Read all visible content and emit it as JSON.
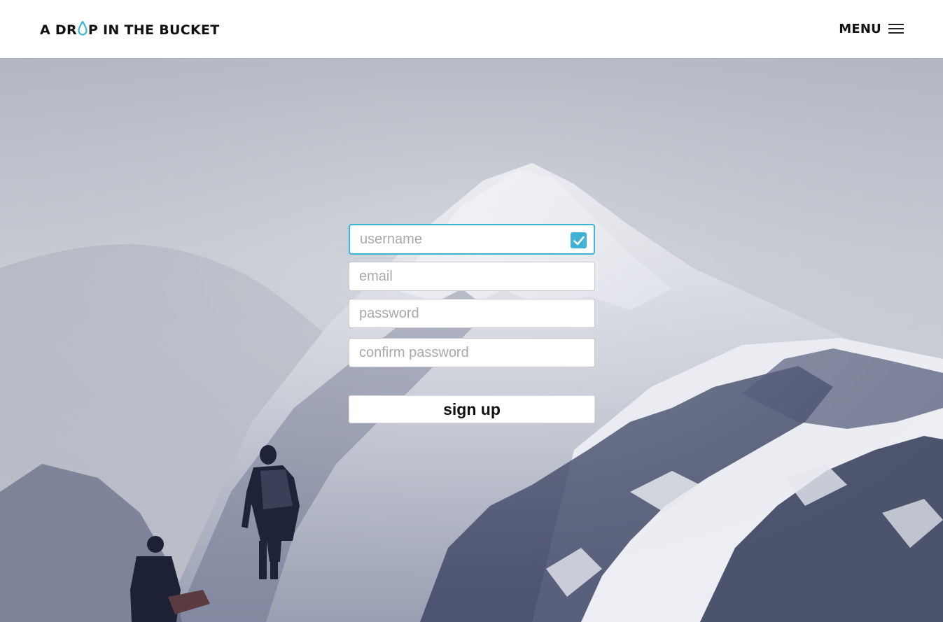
{
  "header": {
    "logo_text_before": "A DR",
    "logo_text_after": "P IN THE BUCKET",
    "menu_label": "MENU"
  },
  "icons": {
    "logo_drop": "water-drop-icon",
    "menu": "hamburger-menu-icon",
    "autofill": "checkmark-icon"
  },
  "colors": {
    "accent": "#3bb6d4",
    "header_bg": "#ffffff",
    "text": "#111111"
  },
  "form": {
    "username_placeholder": "username",
    "email_placeholder": "email",
    "password_placeholder": "password",
    "confirm_placeholder": "confirm password",
    "submit_label": "sign up"
  }
}
